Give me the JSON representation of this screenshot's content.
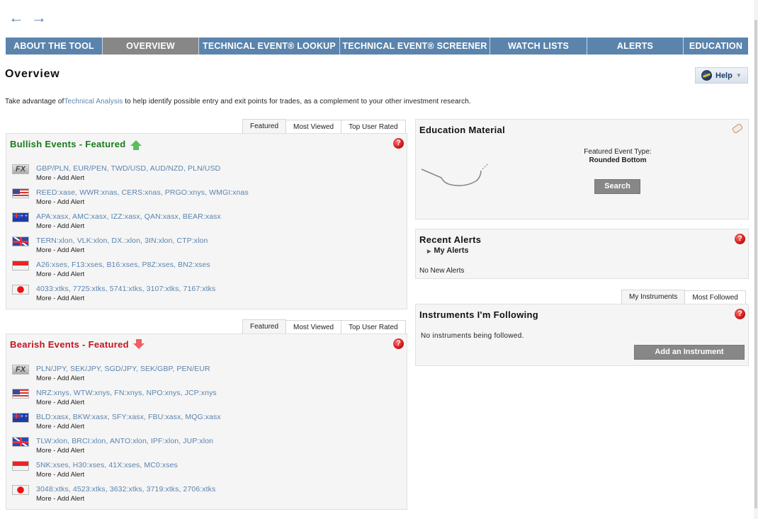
{
  "history": {
    "back_icon": "←",
    "forward_icon": "→"
  },
  "nav": {
    "tabs": [
      {
        "label": "ABOUT THE TOOL",
        "active": false
      },
      {
        "label": "OVERVIEW",
        "active": true
      },
      {
        "label": "TECHNICAL EVENT® LOOKUP",
        "active": false
      },
      {
        "label": "TECHNICAL EVENT® SCREENER",
        "active": false
      },
      {
        "label": "WATCH LISTS",
        "active": false
      },
      {
        "label": "ALERTS",
        "active": false
      },
      {
        "label": "EDUCATION",
        "active": false
      }
    ]
  },
  "page": {
    "title": "Overview",
    "help_label": "Help",
    "intro_before": "Take advantage of",
    "intro_link": "Technical Analysis",
    "intro_after": " to help identify possible entry and exit points for trades, as a complement to your other investment research."
  },
  "event_tabs": [
    "Featured",
    "Most Viewed",
    "Top User Rated"
  ],
  "bullish": {
    "title": "Bullish Events - Featured",
    "help_icon": "?",
    "rows": [
      {
        "market": "fx",
        "symbols": "GBP/PLN, EUR/PEN, TWD/USD, AUD/NZD, PLN/USD"
      },
      {
        "market": "us",
        "symbols": "REED:xase, WWR:xnas, CERS:xnas, PRGO:xnys, WMGI:xnas"
      },
      {
        "market": "au",
        "symbols": "APA:xasx, AMC:xasx, IZZ:xasx, QAN:xasx, BEAR:xasx"
      },
      {
        "market": "uk",
        "symbols": "TERN:xlon, VLK:xlon, DX.:xlon, 3IN:xlon, CTP:xlon"
      },
      {
        "market": "sg",
        "symbols": "A26:xses, F13:xses, B16:xses, P8Z:xses, BN2:xses"
      },
      {
        "market": "jp",
        "symbols": "4033:xtks, 7725:xtks, 5741:xtks, 3107:xtks, 7167:xtks"
      }
    ]
  },
  "bearish": {
    "title": "Bearish Events - Featured",
    "help_icon": "?",
    "rows": [
      {
        "market": "fx",
        "symbols": "PLN/JPY, SEK/JPY, SGD/JPY, SEK/GBP, PEN/EUR"
      },
      {
        "market": "us",
        "symbols": "NRZ:xnys, WTW:xnys, FN:xnys, NPO:xnys, JCP:xnys"
      },
      {
        "market": "au",
        "symbols": "BLD:xasx, BKW:xasx, SFY:xasx, FBU:xasx, MQG:xasx"
      },
      {
        "market": "uk",
        "symbols": "TLW:xlon, BRCI:xlon, ANTO:xlon, IPF:xlon, JUP:xlon"
      },
      {
        "market": "sg",
        "symbols": "5NK:xses, H30:xses, 41X:xses, MC0:xses"
      },
      {
        "market": "jp",
        "symbols": "3048:xtks, 4523:xtks, 3632:xtks, 3719:xtks, 2706:xtks"
      }
    ]
  },
  "row_links": {
    "more": "More",
    "sep": " - ",
    "add_alert": "Add Alert",
    "fx_label": "FX"
  },
  "education": {
    "title": "Education Material",
    "event_type_label": "Featured Event Type:",
    "event_type_value": "Rounded Bottom",
    "search_label": "Search"
  },
  "alerts": {
    "title": "Recent Alerts",
    "my_alerts": "My Alerts",
    "empty": "No New Alerts",
    "help_icon": "?"
  },
  "instruments": {
    "tabs": [
      "My Instruments",
      "Most Followed"
    ],
    "title": "Instruments I'm Following",
    "empty": "No instruments being followed.",
    "add_label": "Add an Instrument",
    "help_icon": "?"
  }
}
